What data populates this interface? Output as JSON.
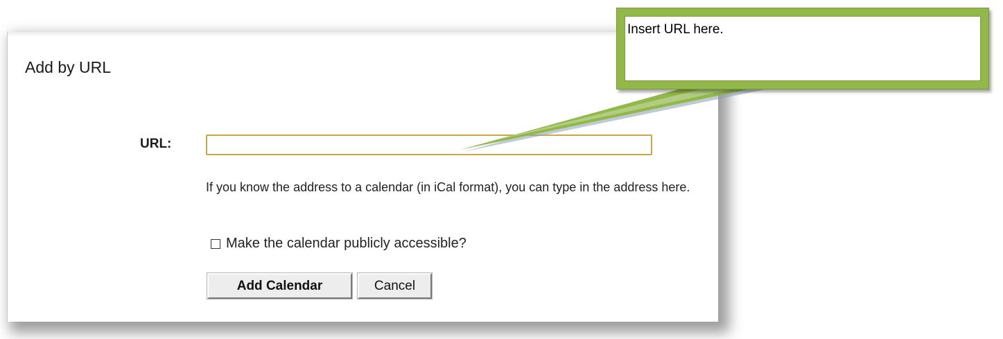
{
  "dialog": {
    "title": "Add by URL",
    "url_label": "URL:",
    "url_value": "",
    "help_text": "If you know the address to a calendar (in iCal format), you can type in the address here.",
    "public_checkbox": {
      "label": "Make the calendar publicly accessible?",
      "checked": false
    },
    "add_button_label": "Add Calendar",
    "cancel_button_label": "Cancel"
  },
  "callout": {
    "text": "Insert URL here.",
    "colors": {
      "border": "#92b84a",
      "fill": "#ffffff"
    }
  },
  "colors": {
    "input_border": "#c9a84a",
    "button_face": "#ededed"
  }
}
